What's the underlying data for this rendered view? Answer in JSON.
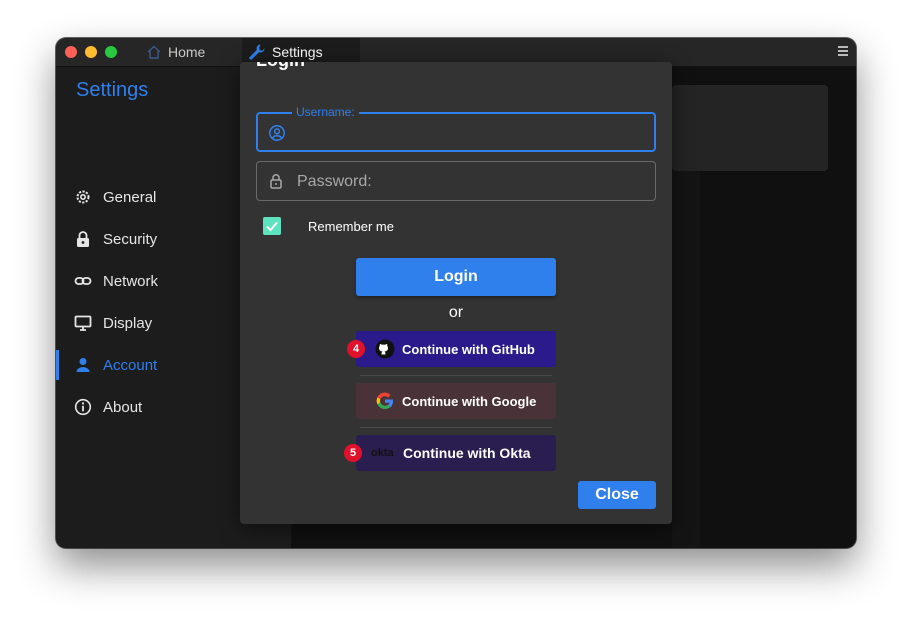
{
  "window": {
    "tabs": [
      {
        "label": "Home",
        "icon": "home-icon"
      },
      {
        "label": "Settings",
        "icon": "wrench-icon"
      }
    ]
  },
  "sidebar": {
    "title": "Settings",
    "items": [
      {
        "label": "General",
        "icon": "gear-icon"
      },
      {
        "label": "Security",
        "icon": "lock-icon"
      },
      {
        "label": "Network",
        "icon": "link-icon"
      },
      {
        "label": "Display",
        "icon": "monitor-icon"
      },
      {
        "label": "Account",
        "icon": "person-icon",
        "active": true
      },
      {
        "label": "About",
        "icon": "info-icon"
      }
    ]
  },
  "dialog": {
    "title": "Login",
    "username": {
      "label": "Username:",
      "value": ""
    },
    "password": {
      "placeholder": "Password:",
      "value": ""
    },
    "remember_label": "Remember me",
    "remember_checked": true,
    "login_label": "Login",
    "or_label": "or",
    "providers": [
      {
        "label": "Continue with GitHub",
        "icon": "github-icon",
        "badge": "4"
      },
      {
        "label": "Continue with Google",
        "icon": "google-icon"
      },
      {
        "label": "Continue with Okta",
        "icon": "okta-icon",
        "icon_text": "okta",
        "badge": "5"
      }
    ],
    "close_label": "Close"
  },
  "colors": {
    "accent": "#2f80ed",
    "checkbox": "#5de3c0",
    "github_bg": "#2b1a8b",
    "google_bg": "#4a3338",
    "okta_bg": "#2a1d4f",
    "badge": "#e0112b"
  }
}
